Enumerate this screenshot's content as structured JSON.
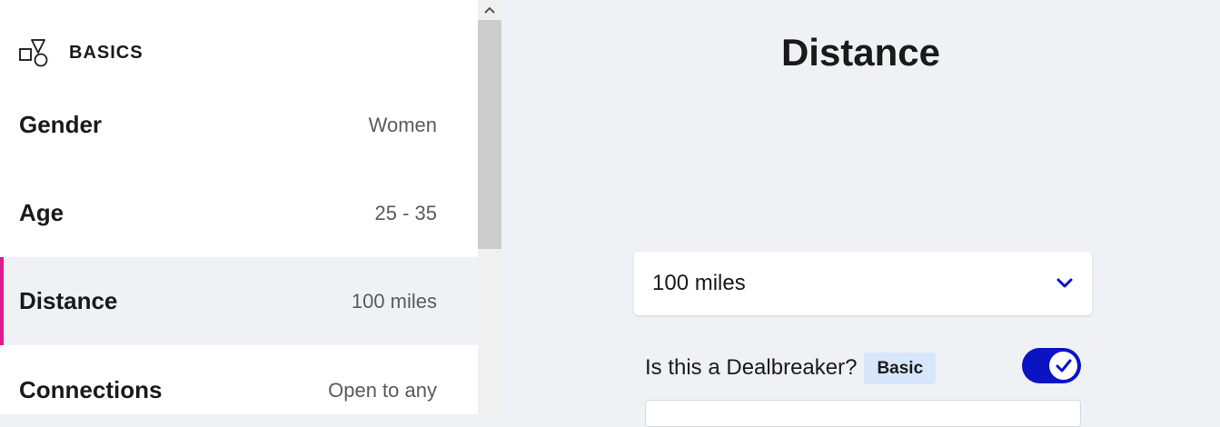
{
  "sidebar": {
    "section": {
      "title": "BASICS",
      "icon": "shapes-icon"
    },
    "items": [
      {
        "label": "Gender",
        "value": "Women"
      },
      {
        "label": "Age",
        "value": "25 - 35"
      },
      {
        "label": "Distance",
        "value": "100 miles",
        "selected": true
      },
      {
        "label": "Connections",
        "value": "Open to any"
      }
    ]
  },
  "main": {
    "title": "Distance",
    "distance_select": {
      "value": "100 miles",
      "icon": "chevron-down-icon"
    },
    "dealbreaker": {
      "label": "Is this a Dealbreaker?",
      "badge": "Basic",
      "toggle_on": true
    }
  },
  "colors": {
    "accent": "#0a14c2",
    "selected_marker": "#e01b8d",
    "badge_bg": "#d7e6fb",
    "page_bg": "#f0f1f5"
  }
}
